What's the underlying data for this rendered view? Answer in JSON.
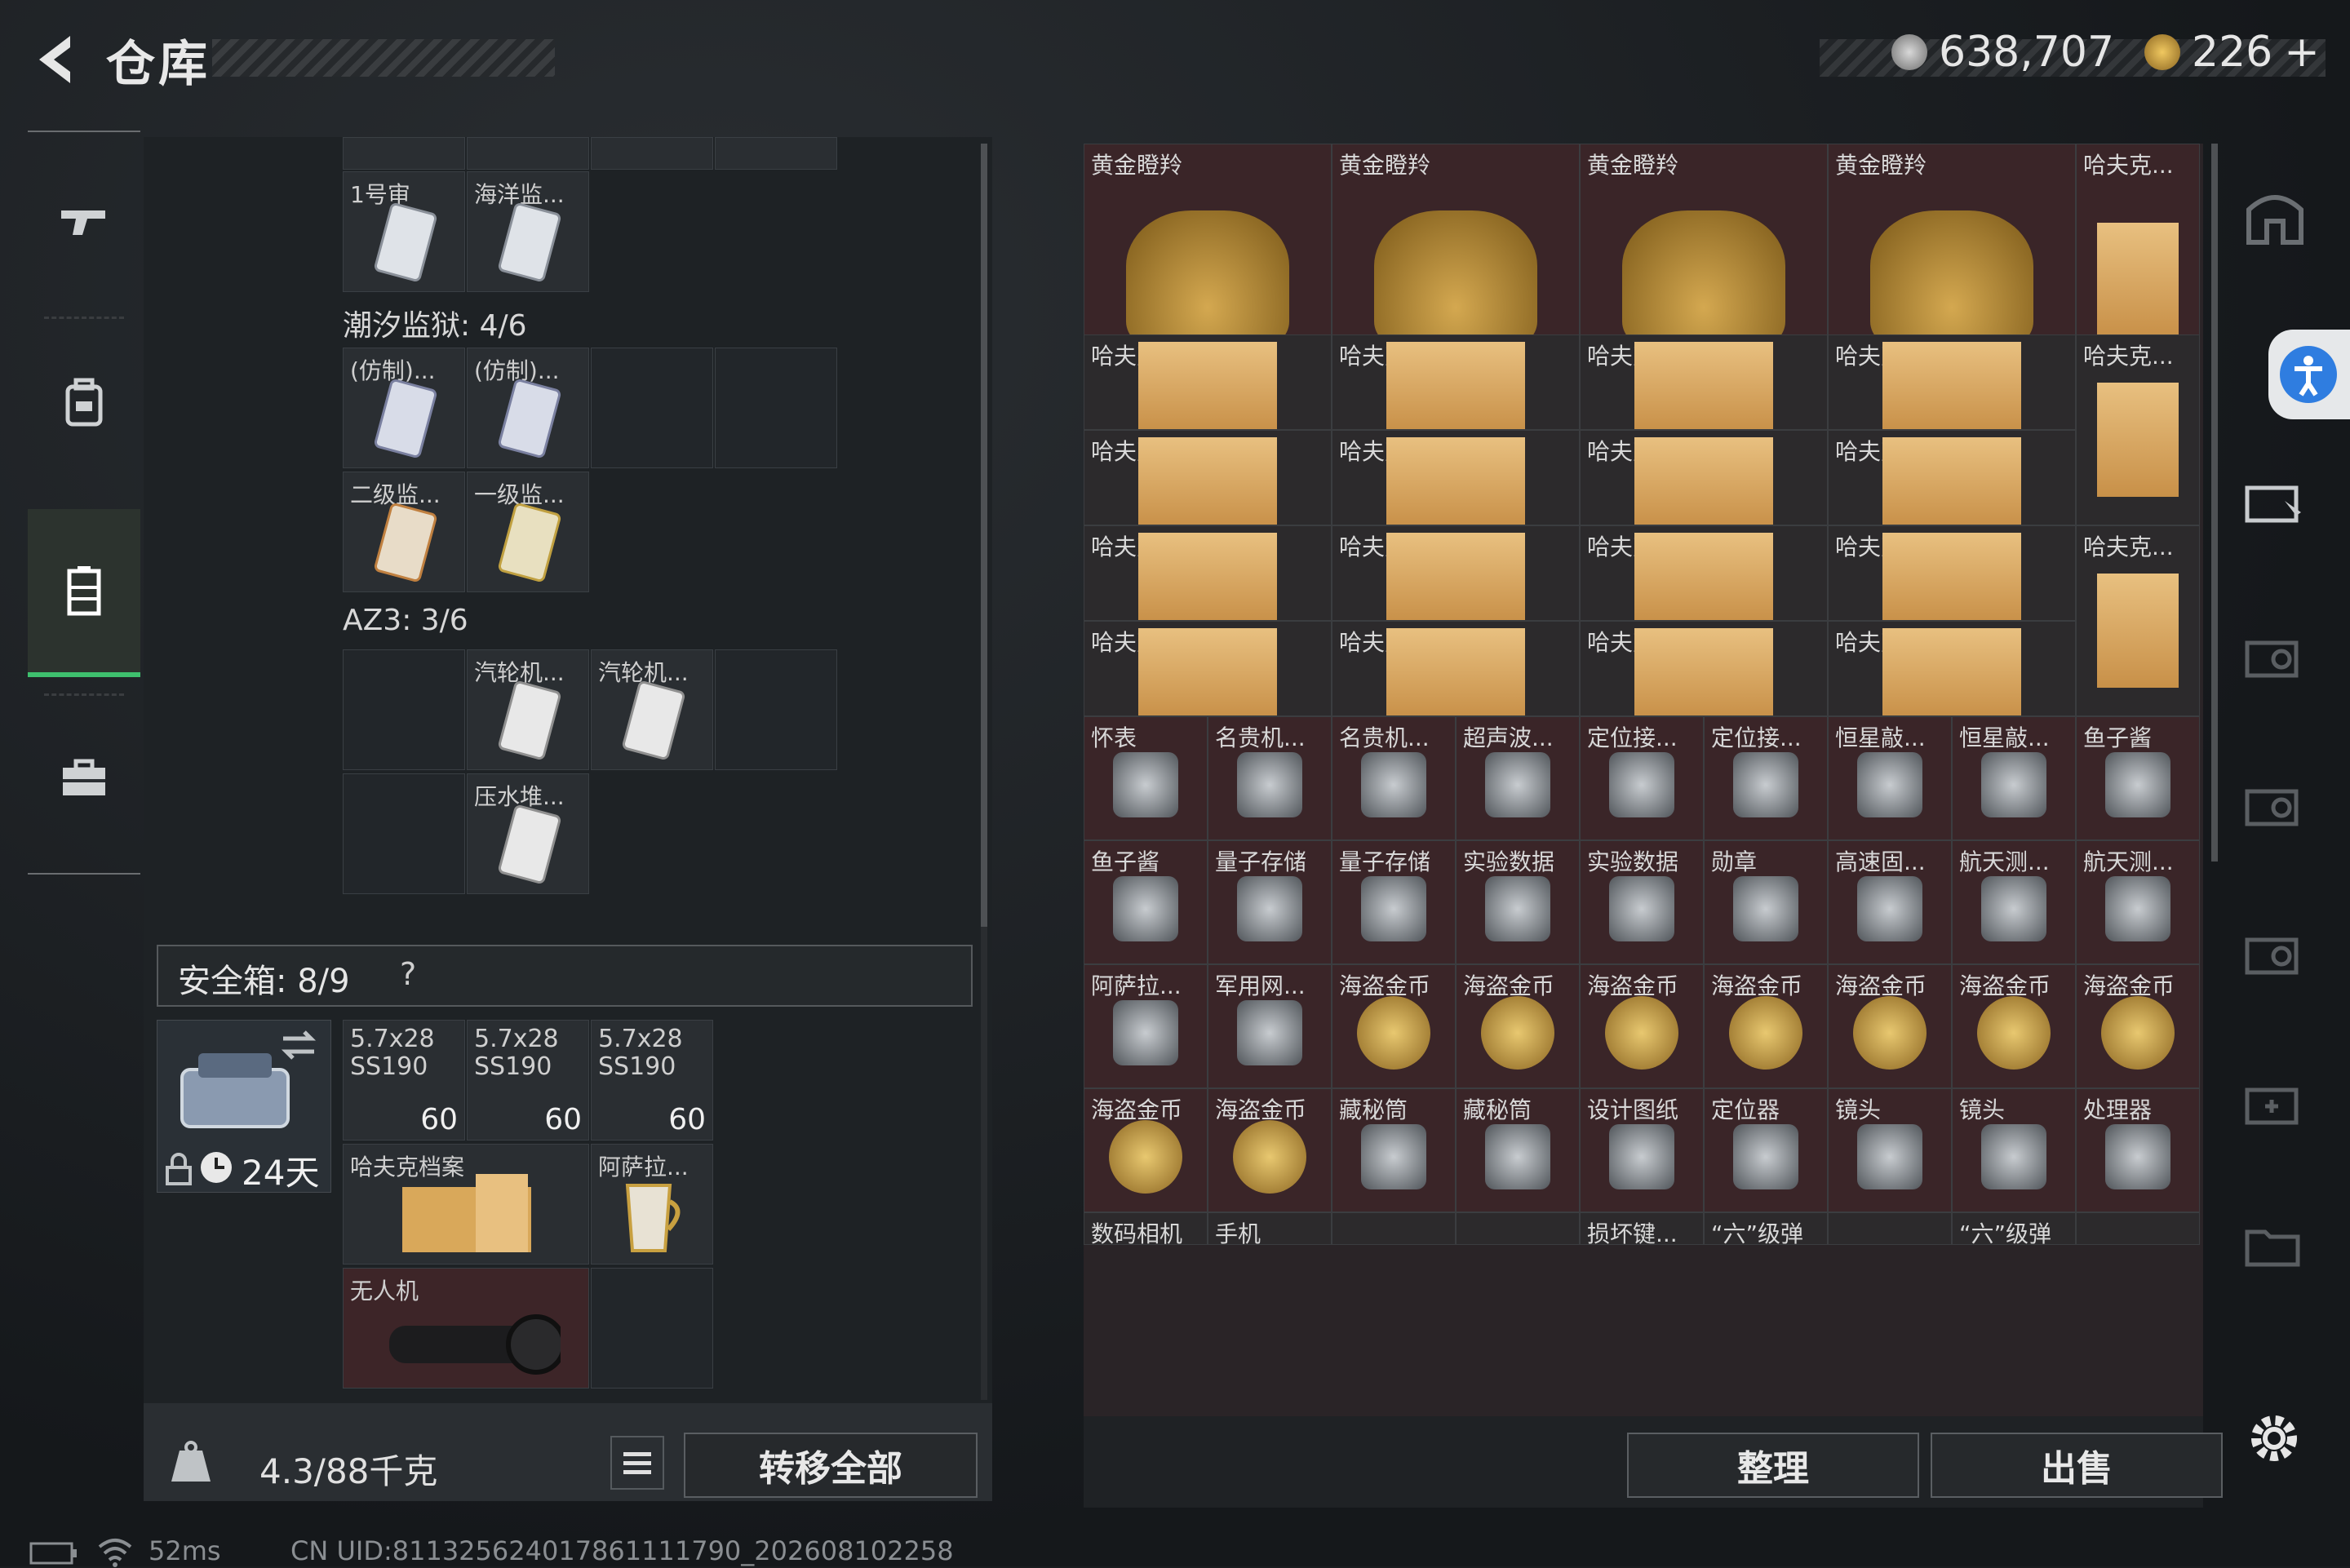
{
  "header": {
    "title": "仓库",
    "currency_a": "638,707",
    "currency_b": "226",
    "currency_b_plus": "+"
  },
  "nav": {
    "items": [
      {
        "icon": "gun-icon"
      },
      {
        "icon": "backpack-icon"
      },
      {
        "icon": "locker-icon",
        "active": true
      },
      {
        "icon": "briefcase-icon"
      }
    ]
  },
  "stash": {
    "top_partial": [
      "",
      "",
      "",
      ""
    ],
    "group1_items": [
      {
        "label": "1号审"
      },
      {
        "label": "海洋监..."
      }
    ],
    "group2_label": "潮汐监狱: 4/6",
    "group2_items": [
      {
        "label": "(仿制)..."
      },
      {
        "label": "(仿制)..."
      },
      {
        "label": "二级监..."
      },
      {
        "label": "一级监..."
      }
    ],
    "group3_label": "AZ3: 3/6",
    "group3_items": [
      {
        "label": "汽轮机..."
      },
      {
        "label": "汽轮机..."
      },
      {
        "label": "压水堆..."
      }
    ]
  },
  "safe": {
    "title": "安全箱: 8/9",
    "help": "?",
    "days": "24天",
    "ammo": [
      {
        "label": "5.7x28 SS190",
        "qty": "60"
      },
      {
        "label": "5.7x28 SS190",
        "qty": "60"
      },
      {
        "label": "5.7x28 SS190",
        "qty": "60"
      }
    ],
    "items": [
      {
        "label": "哈夫克档案"
      },
      {
        "label": "阿萨拉..."
      },
      {
        "label": "无人机"
      }
    ]
  },
  "footer": {
    "weight": "4.3/88千克",
    "transfer_all": "转移全部",
    "organize": "整理",
    "sell": "出售"
  },
  "status": {
    "ping": "52ms",
    "uid": "CN UID:811325624017861111790_202608102258"
  },
  "right_grid": {
    "row0": [
      "黄金瞪羚",
      "黄金瞪羚",
      "黄金瞪羚",
      "黄金瞪羚",
      "哈夫克..."
    ],
    "rows_doc": [
      [
        "哈夫克档案",
        "哈夫克档案",
        "哈夫克档案",
        "哈夫克档案",
        "哈夫克..."
      ],
      [
        "哈夫克档案",
        "哈夫克档案",
        "哈夫克档案",
        "哈夫克档案",
        ""
      ],
      [
        "哈夫克档案",
        "哈夫克档案",
        "哈夫克档案",
        "哈夫克档案",
        "哈夫克..."
      ],
      [
        "哈夫克档案",
        "哈夫克档案",
        "哈夫克档案",
        "哈夫克档案",
        ""
      ]
    ],
    "row5": [
      "怀表",
      "名贵机...",
      "名贵机...",
      "超声波...",
      "定位接...",
      "定位接...",
      "恒星敲...",
      "恒星敲...",
      "鱼子酱"
    ],
    "row6": [
      "鱼子酱",
      "量子存储",
      "量子存储",
      "实验数据",
      "实验数据",
      "勋章",
      "高速固...",
      "航天测...",
      "航天测..."
    ],
    "row7": [
      "阿萨拉...",
      "军用网...",
      "海盗金币",
      "海盗金币",
      "海盗金币",
      "海盗金币",
      "海盗金币",
      "海盗金币",
      "海盗金币"
    ],
    "row8": [
      "海盗金币",
      "海盗金币",
      "藏秘筒",
      "藏秘筒",
      "设计图纸",
      "定位器",
      "镜头",
      "镜头",
      "处理器"
    ],
    "row9": [
      "数码相机",
      "手机",
      "",
      "",
      "损坏键...",
      "“六”级弹",
      "",
      "“六”级弹",
      ""
    ]
  },
  "colors": {
    "accent_green": "#3ec06e",
    "gold": "#c9a04a",
    "red_cell": "#3a2528"
  }
}
